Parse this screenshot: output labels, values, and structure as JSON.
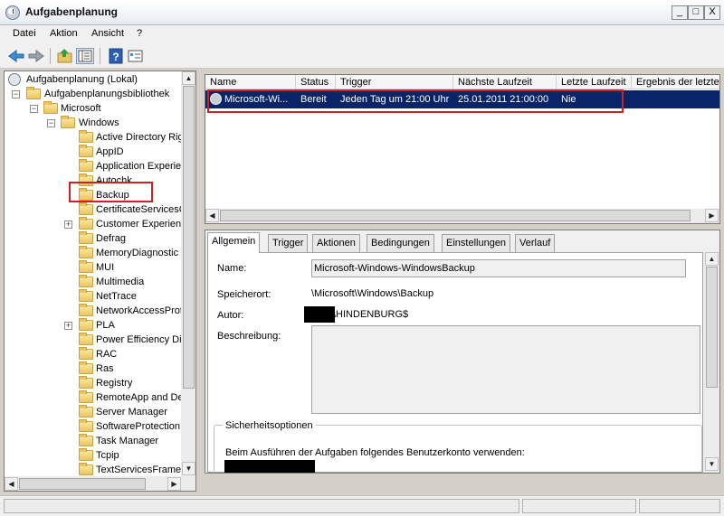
{
  "window": {
    "title": "Aufgabenplanung",
    "minimize_label": "_",
    "maximize_label": "□",
    "close_label": "X"
  },
  "menu": {
    "items": [
      "Datei",
      "Aktion",
      "Ansicht",
      "?"
    ]
  },
  "toolbar": {
    "buttons": [
      "back-arrow-icon",
      "forward-arrow-icon",
      "up-folder-icon",
      "show-hide-tree-icon",
      "help-icon",
      "properties-icon"
    ]
  },
  "tree": {
    "root": "Aufgabenplanung (Lokal)",
    "library": "Aufgabenplanungsbibliothek",
    "microsoft": "Microsoft",
    "windows": "Windows",
    "items": [
      "Active Directory Rig",
      "AppID",
      "Application Experier",
      "Autochk",
      "Backup",
      "CertificateServicesC",
      "Customer Experienc",
      "Defrag",
      "MemoryDiagnostic",
      "MUI",
      "Multimedia",
      "NetTrace",
      "NetworkAccessProt",
      "PLA",
      "Power Efficiency Dia",
      "RAC",
      "Ras",
      "Registry",
      "RemoteApp and De",
      "Server Manager",
      "SoftwareProtection",
      "Task Manager",
      "Tcpip",
      "TextServicesFrame"
    ],
    "selected": "Backup",
    "expand_symbol": "+",
    "collapse_symbol": "−"
  },
  "task_list": {
    "columns": [
      "Name",
      "Status",
      "Trigger",
      "Nächste Laufzeit",
      "Letzte Laufzeit",
      "Ergebnis der letzte"
    ],
    "rows": [
      {
        "name": "Microsoft-Wi...",
        "status": "Bereit",
        "trigger": "Jeden Tag um 21:00 Uhr",
        "next_run": "25.01.2011 21:00:00",
        "last_run": "Nie"
      }
    ]
  },
  "details": {
    "tabs": [
      "Allgemein",
      "Trigger",
      "Aktionen",
      "Bedingungen",
      "Einstellungen",
      "Verlauf"
    ],
    "active_tab": "Allgemein",
    "name_label": "Name:",
    "name_value": "Microsoft-Windows-WindowsBackup",
    "location_label": "Speicherort:",
    "location_value": "\\Microsoft\\Windows\\Backup",
    "author_label": "Autor:",
    "author_value": "\\HINDENBURG$",
    "description_label": "Beschreibung:",
    "description_value": "",
    "security_legend": "Sicherheitsoptionen",
    "security_text": "Beim Ausführen der Aufgaben folgendes Benutzerkonto verwenden:"
  },
  "colors": {
    "selection": "#0a246a",
    "highlight_box": "#cc2222",
    "folder": "#e9c466"
  }
}
